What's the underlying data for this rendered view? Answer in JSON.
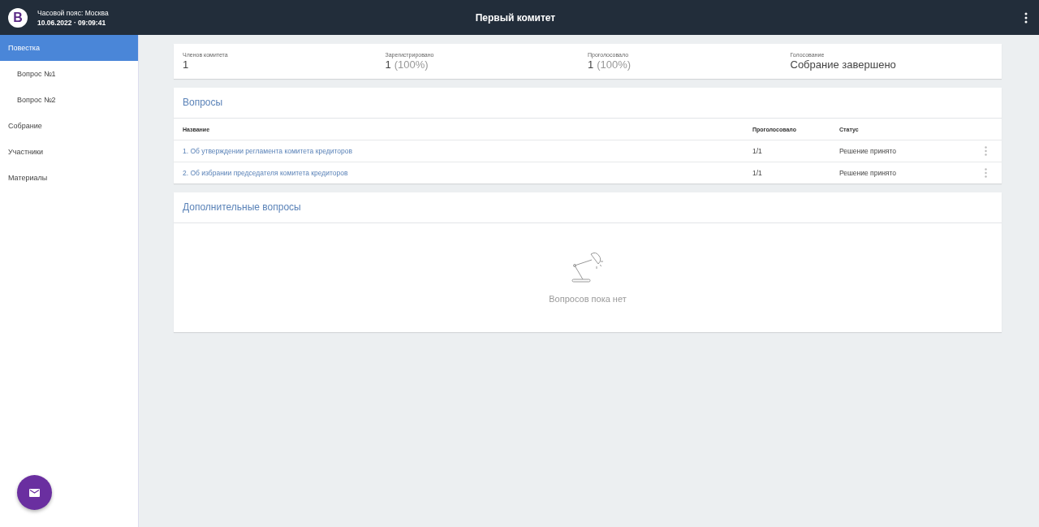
{
  "header": {
    "logo": "B",
    "timezone": "Часовой пояс: Москва",
    "datetime": "10.06.2022 · 09:09:41",
    "title": "Первый комитет"
  },
  "sidebar": {
    "items": [
      {
        "label": "Повестка",
        "selected": true,
        "children": [
          {
            "label": "Вопрос №1",
            "selected": false
          },
          {
            "label": "Вопрос №2",
            "selected": false
          }
        ]
      },
      {
        "label": "Собрание",
        "selected": false
      },
      {
        "label": "Участники",
        "selected": false
      },
      {
        "label": "Материалы",
        "selected": false
      }
    ]
  },
  "stats": [
    {
      "label": "Членов комитета",
      "value": "1"
    },
    {
      "label": "Зарегистрировано",
      "value": "1",
      "percent": "(100%)"
    },
    {
      "label": "Проголосовало",
      "value": "1",
      "percent": "(100%)"
    },
    {
      "label": "Голосование",
      "value": "Собрание завершено"
    }
  ],
  "questions": {
    "title": "Вопросы",
    "columns": [
      "Название",
      "Проголосовало",
      "Статус"
    ],
    "rows": [
      {
        "name": "1. Об утверждении регламента комитета кредиторов",
        "voted": "1/1",
        "status": "Решение принято"
      },
      {
        "name": "2. Об избрании председателя комитета кредиторов",
        "voted": "1/1",
        "status": "Решение принято"
      }
    ]
  },
  "extra": {
    "title": "Дополнительные вопросы",
    "empty_text": "Вопросов пока нет"
  }
}
